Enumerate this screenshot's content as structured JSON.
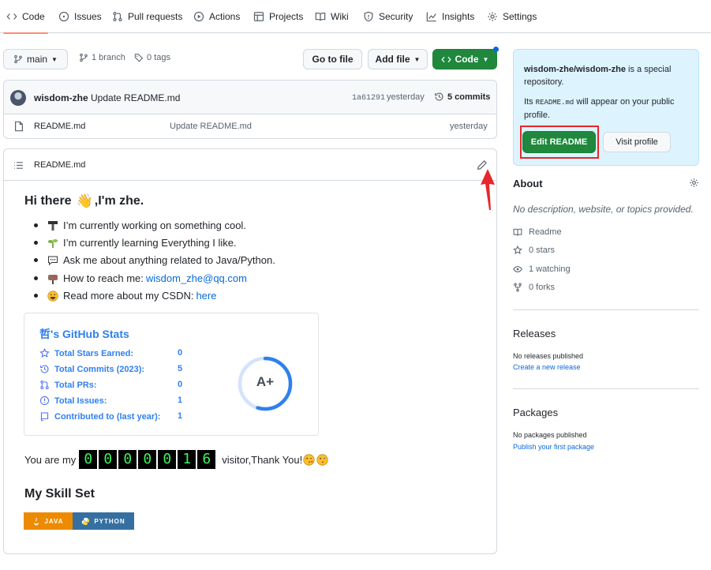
{
  "nav": {
    "tabs": [
      {
        "label": "Code",
        "icon": "code-icon"
      },
      {
        "label": "Issues",
        "icon": "issue-icon"
      },
      {
        "label": "Pull requests",
        "icon": "pull-request-icon"
      },
      {
        "label": "Actions",
        "icon": "play-icon"
      },
      {
        "label": "Projects",
        "icon": "table-icon"
      },
      {
        "label": "Wiki",
        "icon": "book-icon"
      },
      {
        "label": "Security",
        "icon": "shield-icon"
      },
      {
        "label": "Insights",
        "icon": "graph-icon"
      },
      {
        "label": "Settings",
        "icon": "gear-icon"
      }
    ]
  },
  "toolbar": {
    "branch": "main",
    "branches": "1 branch",
    "tags": "0 tags",
    "go_to_file": "Go to file",
    "add_file": "Add file",
    "code": "Code"
  },
  "commit": {
    "author": "wisdom-zhe",
    "message": "Update README.md",
    "sha": "1a61291",
    "time": "yesterday",
    "commits": "5 commits"
  },
  "files": [
    {
      "name": "README.md",
      "message": "Update README.md",
      "time": "yesterday"
    }
  ],
  "readme": {
    "header": "README.md",
    "greeting": "Hi there",
    "greeting_suffix": ",I'm zhe.",
    "bullets": [
      {
        "text": "I’m currently working on something cool."
      },
      {
        "text": "I’m currently learning Everything I like."
      },
      {
        "text": "Ask me about anything related to Java/Python."
      },
      {
        "text": "How to reach me: ",
        "link": "wisdom_zhe@qq.com"
      },
      {
        "text": "Read more about my CSDN: ",
        "link": "here"
      }
    ],
    "stats": {
      "title": "哲's GitHub Stats",
      "rows": [
        {
          "label": "Total Stars Earned:",
          "value": "0"
        },
        {
          "label": "Total Commits (2023):",
          "value": "5"
        },
        {
          "label": "Total PRs:",
          "value": "0"
        },
        {
          "label": "Total Issues:",
          "value": "1"
        },
        {
          "label": "Contributed to (last year):",
          "value": "1"
        }
      ],
      "grade": "A+"
    },
    "visitor_prefix": "You are my",
    "visitor_digits": [
      "0",
      "0",
      "0",
      "0",
      "0",
      "1",
      "6"
    ],
    "visitor_suffix": "visitor,Thank You!",
    "skills_heading": "My Skill Set",
    "badges": [
      {
        "label": "JAVA",
        "color": "#ed8b00"
      },
      {
        "label": "PYTHON",
        "color": "#3670a0"
      }
    ]
  },
  "sidebar": {
    "special_repo": "wisdom-zhe/wisdom-zhe",
    "special_text": " is a special repository.",
    "readme_note_pre": "Its ",
    "readme_note_code": "README.md",
    "readme_note_post": " will appear on your public profile.",
    "edit_readme": "Edit README",
    "visit_profile": "Visit profile",
    "about_heading": "About",
    "about_desc": "No description, website, or topics provided.",
    "about_items": [
      "Readme",
      "0 stars",
      "1 watching",
      "0 forks"
    ],
    "releases_heading": "Releases",
    "releases_none": "No releases published",
    "releases_link": "Create a new release",
    "packages_heading": "Packages",
    "packages_none": "No packages published",
    "packages_link": "Publish your first package"
  },
  "colors": {
    "accent_green": "#1f883d",
    "annotation_red": "#e8262c",
    "link_blue": "#0969da"
  }
}
